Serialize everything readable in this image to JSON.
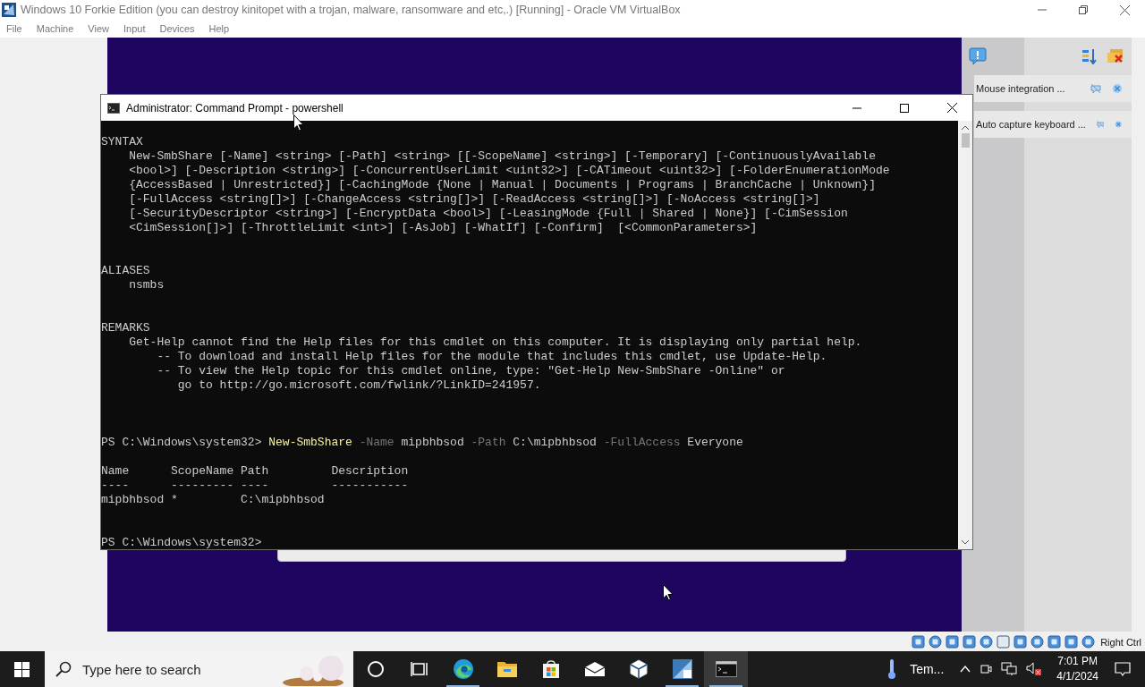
{
  "host_window": {
    "title": "Windows 10 Forkie Edition (you can destroy kinitopet with a trojan, malware, ransomware and etc,.) [Running] - Oracle VM VirtualBox",
    "menu": [
      "File",
      "Machine",
      "View",
      "Input",
      "Devices",
      "Help"
    ]
  },
  "console_window": {
    "title": "Administrator: Command Prompt - powershell",
    "sections": [
      {
        "heading": "SYNTAX",
        "lines": [
          {
            "text": "New-SmbShare [-Name] <string> [-Path] <string> [[-ScopeName] <string>] [-Temporary] [-ContinuouslyAvailable"
          },
          {
            "text": "<bool>] [-Description <string>] [-ConcurrentUserLimit <uint32>] [-CATimeout <uint32>] [-FolderEnumerationMode"
          },
          {
            "text": "{AccessBased | Unrestricted}] [-CachingMode {None | Manual | Documents | Programs | BranchCache | Unknown}]"
          },
          {
            "text": "[-FullAccess <string[]>] [-ChangeAccess <string[]>] [-ReadAccess <string[]>] [-NoAccess <string[]>]"
          },
          {
            "text": "[-SecurityDescriptor <string>] [-EncryptData <bool>] [-LeasingMode {Full | Shared | None}] [-CimSession"
          },
          {
            "text": "<CimSession[]>] [-ThrottleLimit <int>] [-AsJob] [-WhatIf] [-Confirm]  [<CommonParameters>]"
          }
        ]
      },
      {
        "heading": "ALIASES",
        "lines": [
          {
            "text": "nsmbs"
          }
        ]
      },
      {
        "heading": "REMARKS",
        "lines": [
          {
            "text": "Get-Help cannot find the Help files for this cmdlet on this computer. It is displaying only partial help.",
            "children": [
              {
                "text": "-- To download and install Help files for the module that includes this cmdlet, use Update-Help."
              },
              {
                "text": "-- To view the Help topic for this cmdlet online, type: \"Get-Help New-SmbShare -Online\" or",
                "children": [
                  {
                    "text": "go to http://go.microsoft.com/fwlink/?LinkID=241957."
                  }
                ]
              }
            ]
          }
        ]
      }
    ],
    "command": [
      {
        "kind": "prompt",
        "text": "PS C:\\Windows\\system32> "
      },
      {
        "kind": "cmdlet",
        "text": "New-SmbShare"
      },
      {
        "kind": "param",
        "text": " -Name"
      },
      {
        "kind": "arg",
        "text": " mipbhbsod"
      },
      {
        "kind": "param",
        "text": " -Path"
      },
      {
        "kind": "arg",
        "text": " C:\\mipbhbsod"
      },
      {
        "kind": "param",
        "text": " -FullAccess"
      },
      {
        "kind": "arg",
        "text": " Everyone"
      }
    ],
    "output": {
      "columns": [
        "Name",
        "ScopeName",
        "Path",
        "Description"
      ],
      "separators": [
        "----",
        "---------",
        "----",
        "-----------"
      ],
      "rows": [
        {
          "name": "mipbhbsod",
          "scope_name": "*",
          "path": "C:\\mipbhbsod"
        }
      ]
    },
    "prompt": "PS C:\\Windows\\system32>"
  },
  "notifications": [
    {
      "text": "Mouse integration ..."
    },
    {
      "text": "Auto capture keyboard ..."
    }
  ],
  "status_bar": {
    "host_key": "Right Ctrl"
  },
  "taskbar": {
    "search_placeholder": "Type here to search",
    "apps": [
      {
        "kind": "cortana",
        "selected": false,
        "running": false
      },
      {
        "kind": "task-view",
        "selected": false,
        "running": false
      },
      {
        "kind": "edge",
        "selected": false,
        "running": true
      },
      {
        "kind": "explorer",
        "selected": false,
        "running": false
      },
      {
        "kind": "store",
        "selected": false,
        "running": false
      },
      {
        "kind": "mail",
        "selected": false,
        "running": false
      },
      {
        "kind": "virtualbox",
        "selected": false,
        "running": false
      },
      {
        "kind": "app",
        "selected": false,
        "running": true
      },
      {
        "kind": "terminal",
        "selected": true,
        "running": true
      }
    ],
    "weather": "Tem...",
    "time": "7:01 PM",
    "date": "4/1/2024"
  }
}
